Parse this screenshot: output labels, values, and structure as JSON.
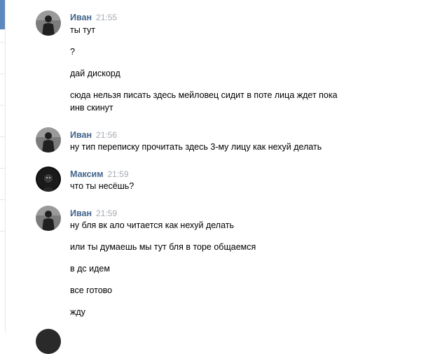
{
  "messages": [
    {
      "author": "Иван",
      "time": "21:55",
      "avatar": "user-avatar",
      "lines": [
        "ты тут",
        "?",
        "дай дискорд",
        "сюда нельзя писать здесь мейловец сидит в поте лица ждет пока",
        "инв скинут"
      ]
    },
    {
      "author": "Иван",
      "time": "21:56",
      "avatar": "user-avatar",
      "lines": [
        "ну тип переписку прочитать здесь 3-му лицу как нехуй делать"
      ]
    },
    {
      "author": "Максим",
      "time": "21:59",
      "avatar": "user-avatar",
      "lines": [
        "что ты несёшь?"
      ]
    },
    {
      "author": "Иван",
      "time": "21:59",
      "avatar": "user-avatar",
      "lines": [
        "ну бля вк ало читается как нехуй делать",
        "или ты думаешь мы тут бля в торе общаемся",
        "в дс идем",
        "все готово",
        "жду"
      ]
    }
  ]
}
